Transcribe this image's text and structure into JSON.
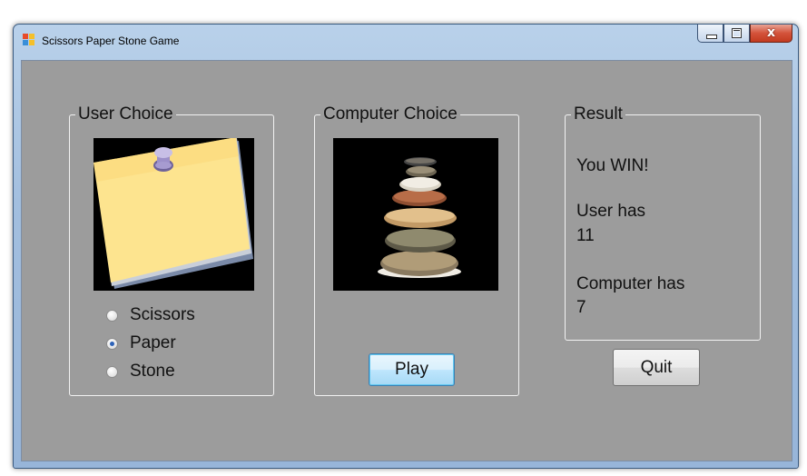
{
  "window": {
    "title": "Scissors Paper Stone Game",
    "close_glyph": "x"
  },
  "user_choice": {
    "legend": "User Choice",
    "image": "sticky-note-paper",
    "options": [
      {
        "label": "Scissors",
        "checked": false
      },
      {
        "label": "Paper",
        "checked": true
      },
      {
        "label": "Stone",
        "checked": false
      }
    ]
  },
  "computer_choice": {
    "legend": "Computer Choice",
    "image": "stacked-stones",
    "play_label": "Play"
  },
  "result": {
    "legend": "Result",
    "outcome": "You WIN!",
    "user_label": "User has",
    "user_score": "11",
    "computer_label": "Computer has",
    "computer_score": "7"
  },
  "quit_label": "Quit",
  "colors": {
    "client_bg": "#9c9c9c",
    "note_yellow": "#fde48f",
    "pin_purple": "#a79bd0"
  }
}
